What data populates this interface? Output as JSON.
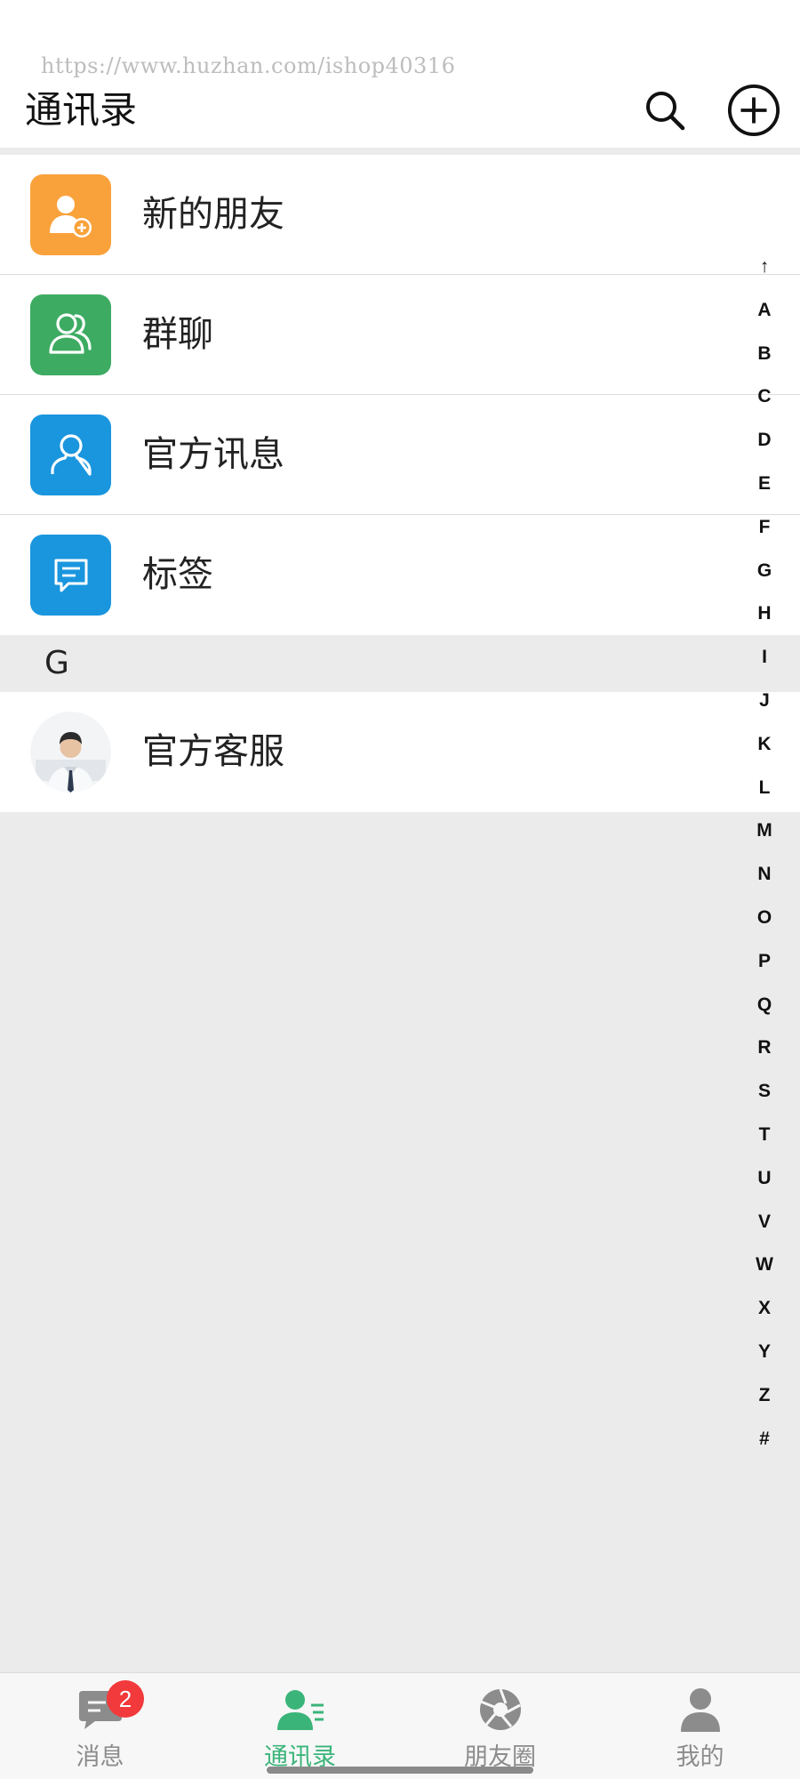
{
  "watermark": "https://www.huzhan.com/ishop40316",
  "header": {
    "title": "通讯录"
  },
  "menu_items": [
    {
      "label": "新的朋友",
      "icon": "add-friend-icon",
      "color": "#f9a23b"
    },
    {
      "label": "群聊",
      "icon": "group-chat-icon",
      "color": "#3dab62"
    },
    {
      "label": "官方讯息",
      "icon": "official-user-icon",
      "color": "#1a96de"
    },
    {
      "label": "标签",
      "icon": "tag-message-icon",
      "color": "#1a96de"
    }
  ],
  "sections": [
    {
      "letter": "G",
      "contacts": [
        {
          "name": "官方客服",
          "avatar": "customer-service-avatar"
        }
      ]
    }
  ],
  "alpha_index": [
    "↑",
    "A",
    "B",
    "C",
    "D",
    "E",
    "F",
    "G",
    "H",
    "I",
    "J",
    "K",
    "L",
    "M",
    "N",
    "O",
    "P",
    "Q",
    "R",
    "S",
    "T",
    "U",
    "V",
    "W",
    "X",
    "Y",
    "Z",
    "#"
  ],
  "tabs": [
    {
      "label": "消息",
      "icon": "chat-icon",
      "badge": "2",
      "active": false
    },
    {
      "label": "通讯录",
      "icon": "contacts-icon",
      "active": true
    },
    {
      "label": "朋友圈",
      "icon": "moments-icon",
      "active": false
    },
    {
      "label": "我的",
      "icon": "profile-icon",
      "active": false
    }
  ],
  "colors": {
    "accent": "#3bb47a",
    "badge": "#f2393b",
    "background": "#ebebeb"
  }
}
